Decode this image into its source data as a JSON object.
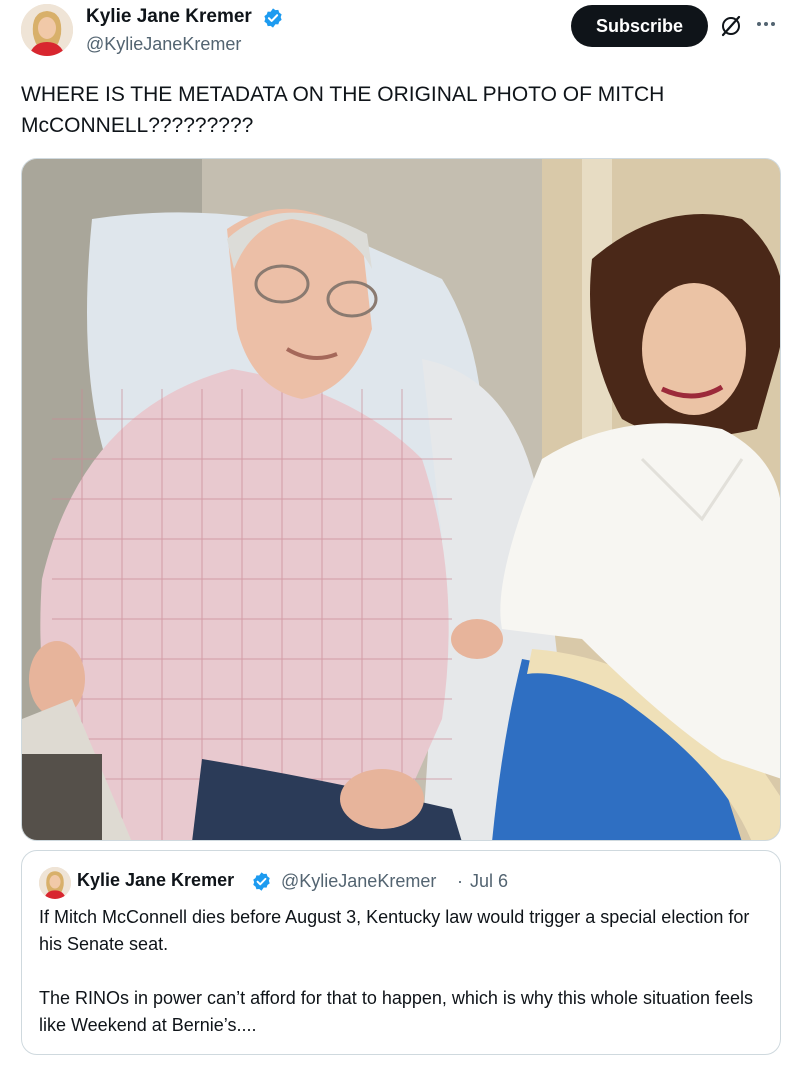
{
  "author": {
    "name": "Kylie Jane Kremer",
    "handle": "@KylieJaneKremer",
    "verified": true,
    "verified_color": "#1d9bf0"
  },
  "actions": {
    "subscribe_label": "Subscribe",
    "grok_icon": "grok-icon",
    "more_icon": "more-horizontal-icon"
  },
  "tweet": {
    "text": "WHERE IS THE METADATA ON THE ORIGINAL PHOTO OF MITCH\nMcCONNELL?????????"
  },
  "media": {
    "type": "photo"
  },
  "quoted": {
    "name": "Kylie Jane Kremer",
    "handle": "@KylieJaneKremer",
    "separator": "·",
    "date": "Jul 6",
    "paragraph1": "If Mitch McConnell dies before August 3, Kentucky law would trigger a special election for his Senate seat.",
    "paragraph2": "The RINOs in power can’t afford for that to happen, which is why this whole situation feels like Weekend at Bernie’s...."
  },
  "colors": {
    "text_primary": "#0f1419",
    "text_secondary": "#536471",
    "border": "#cfd9de",
    "button_bg": "#0f1419"
  }
}
